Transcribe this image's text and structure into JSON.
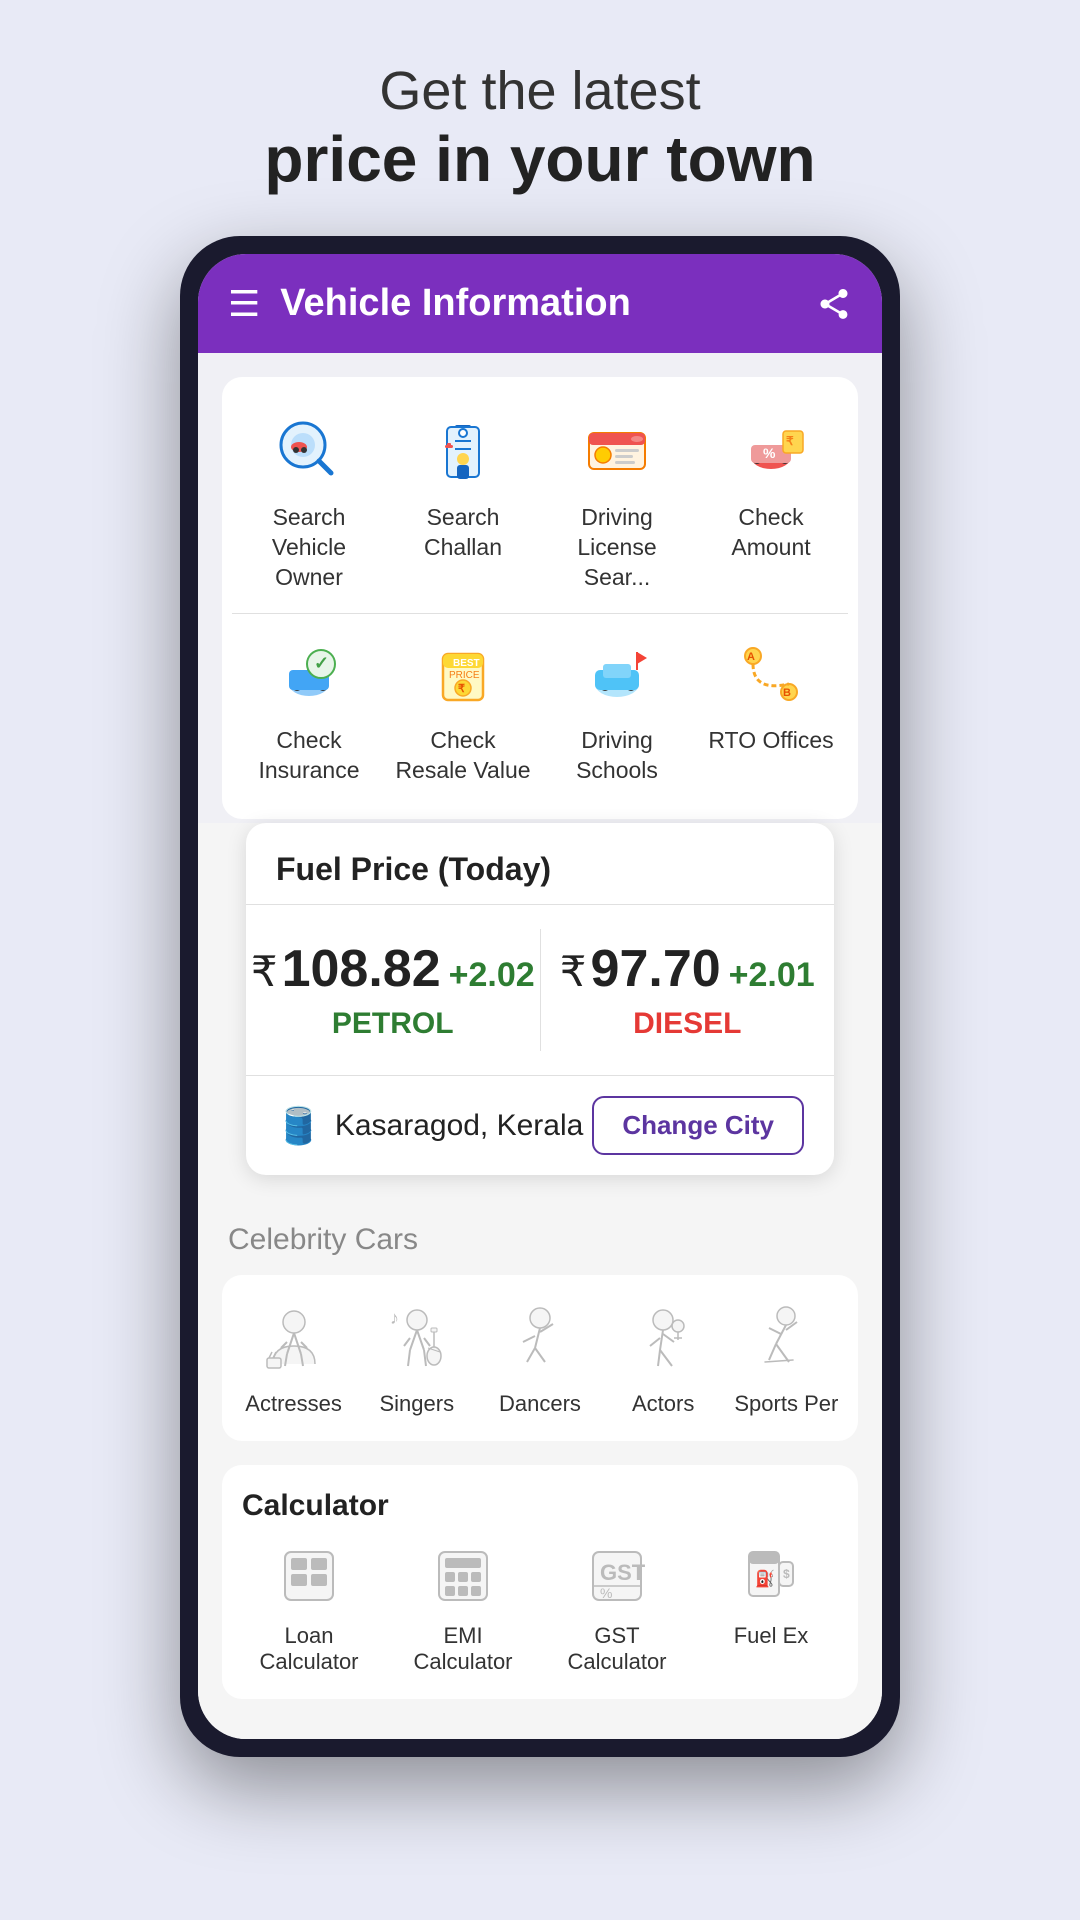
{
  "headline": {
    "top": "Get the latest",
    "bold": "price in your town"
  },
  "appbar": {
    "title": "Vehicle Information"
  },
  "grid": {
    "row1": [
      {
        "id": "search-vehicle-owner",
        "label": "Search Vehicle Owner",
        "icon": "🔍"
      },
      {
        "id": "search-challan",
        "label": "Search Challan",
        "icon": "👮"
      },
      {
        "id": "driving-license",
        "label": "Driving License Sear...",
        "icon": "🪪"
      },
      {
        "id": "check-amount",
        "label": "Check Amount",
        "icon": "🏷️"
      }
    ],
    "row2": [
      {
        "id": "check-insurance",
        "label": "Check Insurance",
        "icon": "🛡️"
      },
      {
        "id": "check-resale",
        "label": "Check Resale Value",
        "icon": "💰"
      },
      {
        "id": "driving-schools",
        "label": "Driving Schools",
        "icon": "🚗"
      },
      {
        "id": "rto-offices",
        "label": "RTO Offices",
        "icon": "🗺️"
      }
    ]
  },
  "fuel": {
    "title": "Fuel Price (Today)",
    "petrol": {
      "amount": "108.82",
      "change": "+2.02",
      "label": "PETROL"
    },
    "diesel": {
      "amount": "97.70",
      "change": "+2.01",
      "label": "DIESEL"
    },
    "location": "Kasaragod, Kerala",
    "change_city_btn": "Change City",
    "currency_symbol": "₹"
  },
  "celebrity": {
    "section_label": "Celebrity Cars",
    "items": [
      {
        "id": "actresses",
        "label": "Actresses",
        "icon": "actress"
      },
      {
        "id": "singers",
        "label": "Singers",
        "icon": "singer"
      },
      {
        "id": "dancers",
        "label": "Dancers",
        "icon": "dancer"
      },
      {
        "id": "actors",
        "label": "Actors",
        "icon": "actor"
      },
      {
        "id": "sports-persons",
        "label": "Sports Per",
        "icon": "sports"
      }
    ]
  },
  "calculator": {
    "section_header": "Calculator",
    "items": [
      {
        "id": "loan-calculator",
        "label": "Loan Calculator",
        "icon": "loan"
      },
      {
        "id": "emi-calculator",
        "label": "EMI Calculator",
        "icon": "emi"
      },
      {
        "id": "gst-calculator",
        "label": "GST Calculator",
        "icon": "gst"
      },
      {
        "id": "fuel-ex",
        "label": "Fuel Ex",
        "icon": "fuel"
      }
    ]
  }
}
